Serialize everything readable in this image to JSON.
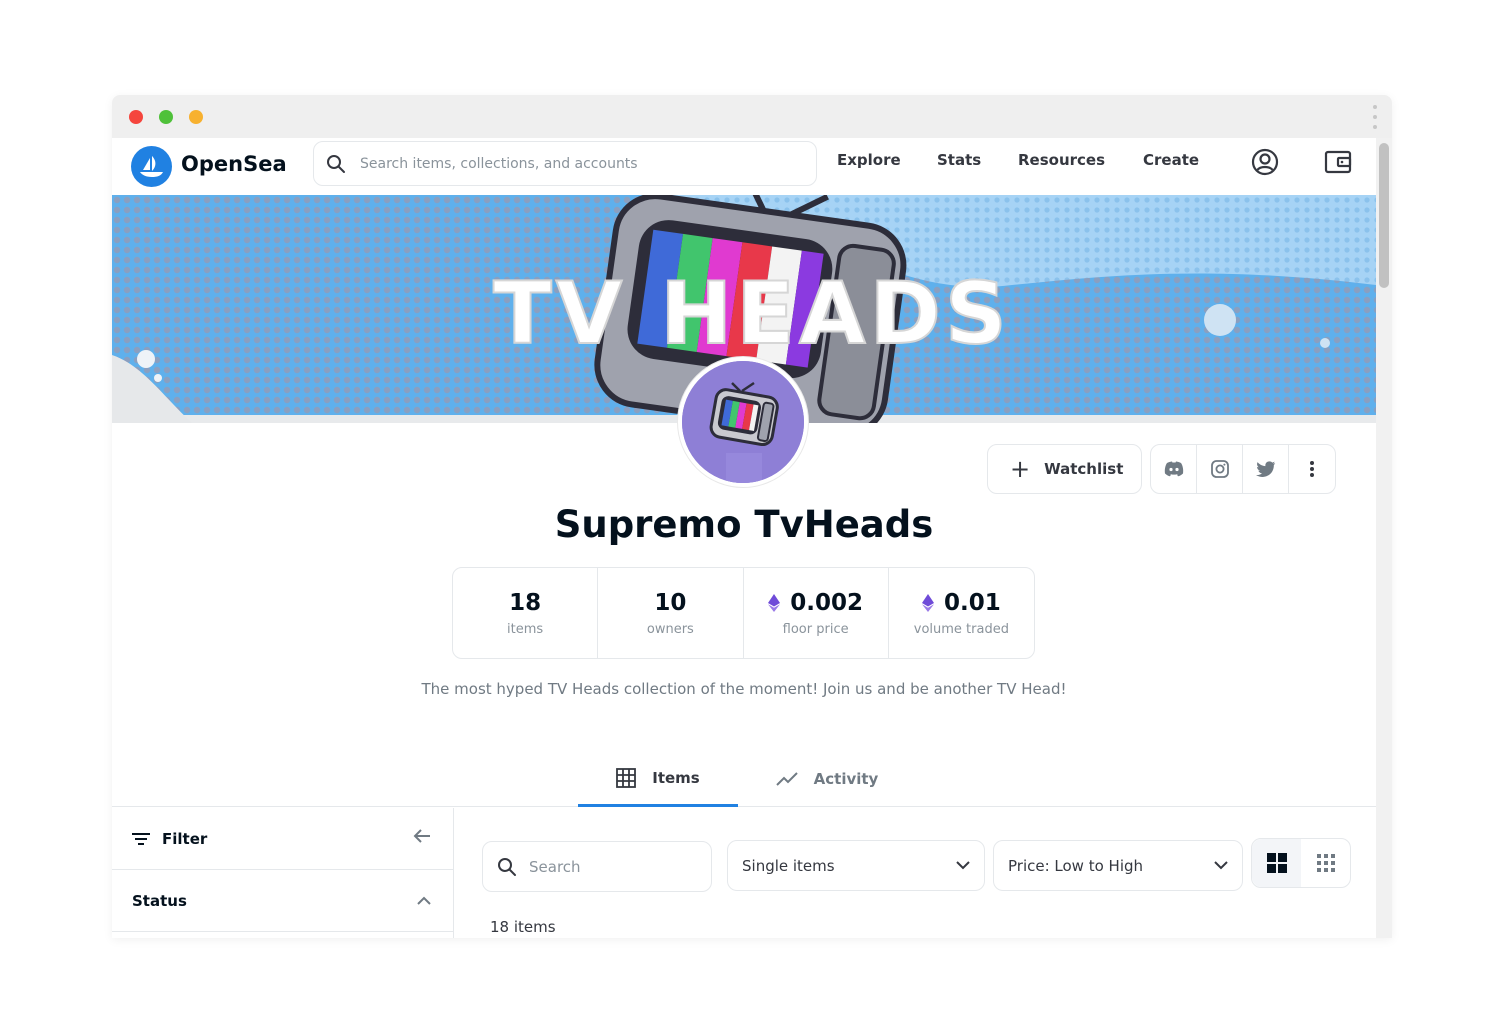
{
  "browser": {
    "menu_icon": "kebab-icon"
  },
  "nav": {
    "logo_text": "OpenSea",
    "search_placeholder": "Search items, collections, and accounts",
    "links": [
      "Explore",
      "Stats",
      "Resources",
      "Create"
    ],
    "icons": [
      "profile-icon",
      "wallet-icon"
    ]
  },
  "banner": {
    "text": "TV HEADS"
  },
  "actions": {
    "watchlist_label": "Watchlist",
    "socials": [
      "discord-icon",
      "instagram-icon",
      "twitter-icon",
      "more-icon"
    ]
  },
  "collection": {
    "name": "Supremo TvHeads",
    "description": "The most hyped TV Heads collection of the moment! Join us and be another TV Head!",
    "stats": [
      {
        "value": "18",
        "label": "items",
        "eth": false
      },
      {
        "value": "10",
        "label": "owners",
        "eth": false
      },
      {
        "value": "0.002",
        "label": "floor price",
        "eth": true
      },
      {
        "value": "0.01",
        "label": "volume traded",
        "eth": true
      }
    ]
  },
  "tabs": [
    {
      "label": "Items",
      "icon": "grid-icon",
      "active": true
    },
    {
      "label": "Activity",
      "icon": "activity-icon",
      "active": false
    }
  ],
  "sidebar": {
    "filter_label": "Filter",
    "status_label": "Status"
  },
  "toolbar": {
    "search_placeholder": "Search",
    "type_select": "Single items",
    "sort_select": "Price: Low to High"
  },
  "results": {
    "count_text": "18 items"
  },
  "colors": {
    "accent": "#2081e2",
    "eth": "#6f4bd8"
  }
}
